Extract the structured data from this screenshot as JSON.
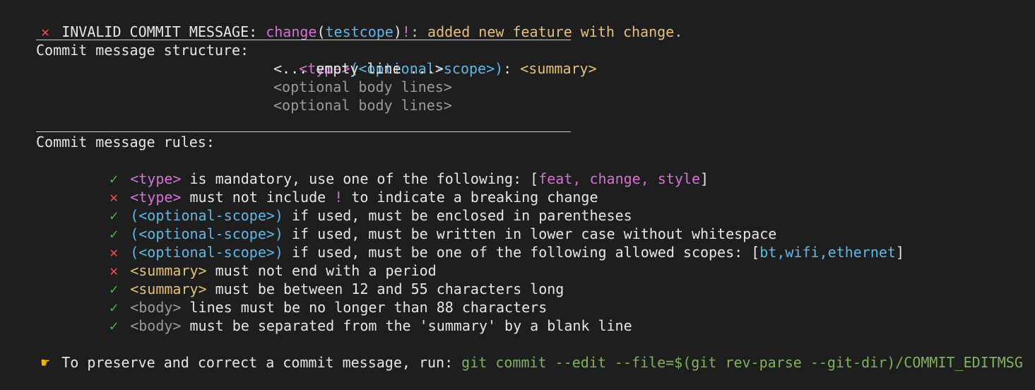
{
  "header": {
    "icon": "cross-icon",
    "label": "INVALID COMMIT MESSAGE:",
    "type": "change",
    "scope_open": "(",
    "scope": "testcope",
    "scope_close": ")",
    "bang": "!",
    "colon": ":",
    "summary": "added new feature with change."
  },
  "structure": {
    "title": "Commit message structure:",
    "type_token": "<type>",
    "scope_token": "(<optional-scope>)",
    "colon": ":",
    "summary_token": "<summary>",
    "empty_line": "<... empty line ...>",
    "body_lines": [
      "<optional body lines>",
      "<optional body lines>"
    ]
  },
  "rules": {
    "title": "Commit message rules:",
    "items": [
      {
        "status": "pass",
        "icon": "check-icon",
        "token": "<type>",
        "token_kind": "type",
        "text": " is mandatory, use one of the following: ",
        "list_open": "[",
        "list": "feat, change, style",
        "list_kind": "type",
        "list_close": "]"
      },
      {
        "status": "fail",
        "icon": "cross-icon",
        "token": "<type>",
        "token_kind": "type",
        "text_before": " must not include ",
        "bang": "!",
        "text_after": " to indicate a breaking change"
      },
      {
        "status": "pass",
        "icon": "check-icon",
        "token": "(<optional-scope>)",
        "token_kind": "scope",
        "text": " if used, must be enclosed in parentheses"
      },
      {
        "status": "pass",
        "icon": "check-icon",
        "token": "(<optional-scope>)",
        "token_kind": "scope",
        "text": " if used, must be written in lower case without whitespace"
      },
      {
        "status": "fail",
        "icon": "cross-icon",
        "token": "(<optional-scope>)",
        "token_kind": "scope",
        "text": " if used, must be one of the following allowed scopes: ",
        "list_open": "[",
        "list": "bt,wifi,ethernet",
        "list_kind": "scope",
        "list_close": "]"
      },
      {
        "status": "fail",
        "icon": "cross-icon",
        "token": "<summary>",
        "token_kind": "summary",
        "text": " must not end with a period"
      },
      {
        "status": "pass",
        "icon": "check-icon",
        "token": "<summary>",
        "token_kind": "summary",
        "text": " must be between 12 and 55 characters long"
      },
      {
        "status": "pass",
        "icon": "check-icon",
        "token": "<body>",
        "token_kind": "body",
        "text": " lines must be no longer than 88 characters"
      },
      {
        "status": "pass",
        "icon": "check-icon",
        "token": "<body>",
        "token_kind": "body",
        "text": " must be separated from the 'summary' by a blank line"
      }
    ]
  },
  "footer": {
    "icon": "pointing-hand-icon",
    "text": "To preserve and correct a commit message, run: ",
    "command": "git commit --edit --file=$(git rev-parse --git-dir)/COMMIT_EDITMSG"
  },
  "colors": {
    "background": "#1e1e1e",
    "error": "#f14c4c",
    "type": "#d670d6",
    "scope": "#5fb7e8",
    "summary": "#e5c07b",
    "body": "#9a9a9a",
    "check": "#3fc43f",
    "command": "#7fb35a"
  }
}
